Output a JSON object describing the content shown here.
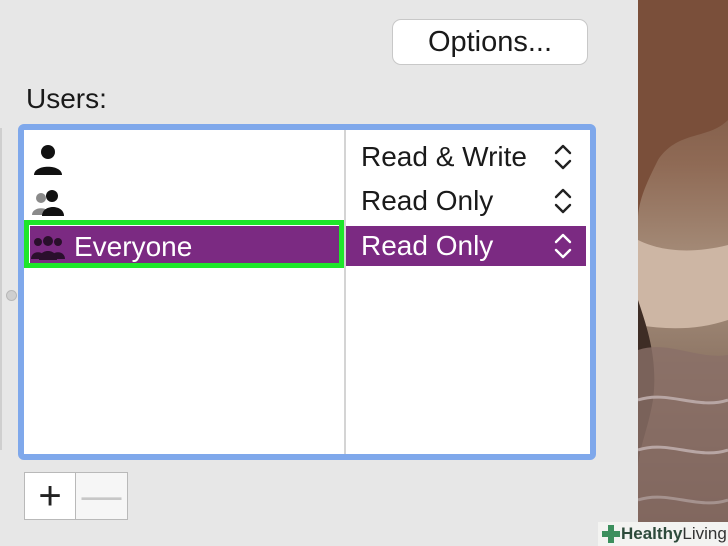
{
  "options_button": {
    "label": "Options..."
  },
  "users_label": "Users:",
  "rows": [
    {
      "name": "",
      "privilege": "Read & Write",
      "icon": "person-icon",
      "selected": false
    },
    {
      "name": "",
      "privilege": "Read Only",
      "icon": "group-icon",
      "selected": false
    },
    {
      "name": "Everyone",
      "privilege": "Read Only",
      "icon": "everyone-icon",
      "selected": true
    }
  ],
  "buttons": {
    "add": "+",
    "remove": "—"
  },
  "watermark": {
    "brand_bold": "Healthy",
    "brand_rest": " Living"
  },
  "colors": {
    "selection": "#7b2a82",
    "highlight": "#1ee62a",
    "table_border": "#7fa8eb"
  }
}
